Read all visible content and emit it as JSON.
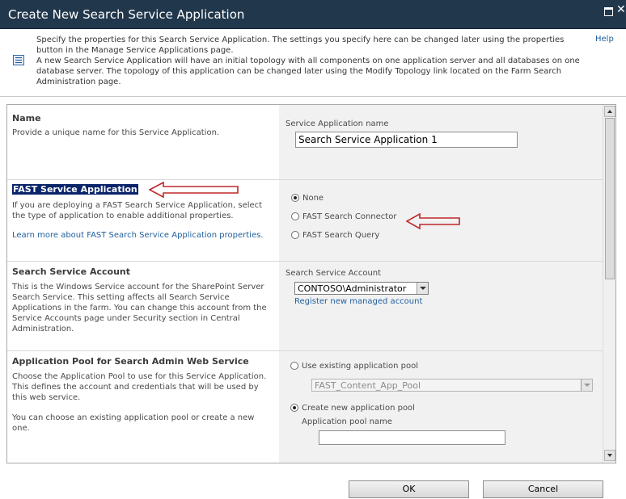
{
  "dialog": {
    "title": "Create New Search Service Application",
    "help_label": "Help",
    "description_1": "Specify the properties for this Search Service Application. The settings you specify here can be changed later using the properties button in the Manage Service Applications page.",
    "description_2": "A new Search Service Application will have an initial topology with all components on one application server and all databases on one database server. The topology of this application can be changed later using the Modify Topology link located on the Farm Search Administration page."
  },
  "sections": {
    "name": {
      "heading": "Name",
      "text": "Provide a unique name for this Service Application.",
      "field_label": "Service Application name",
      "field_value": "Search Service Application 1"
    },
    "fast": {
      "heading": "FAST Service Application",
      "text": "If you are deploying a FAST Search Service Application, select the type of application to enable additional properties.",
      "link": "Learn more about FAST Search Service Application properties.",
      "options": [
        "None",
        "FAST Search Connector",
        "FAST Search Query"
      ],
      "selected": "None"
    },
    "account": {
      "heading": "Search Service Account",
      "text": "This is the Windows Service account for the SharePoint Server Search Service. This setting affects all Search Service Applications in the farm. You can change this account from the Service Accounts page under Security section in Central Administration.",
      "field_label": "Search Service Account",
      "selected_account": "CONTOSO\\Administrator",
      "register_link": "Register new managed account"
    },
    "apppool": {
      "heading": "Application Pool for Search Admin Web Service",
      "text_1": "Choose the Application Pool to use for this Service Application. This defines the account and credentials that will be used by this web service.",
      "text_2": "You can choose an existing application pool or create a new one.",
      "use_existing_label": "Use existing application pool",
      "existing_pool": "FAST_Content_App_Pool",
      "create_new_label": "Create new application pool",
      "pool_name_label": "Application pool name",
      "pool_name_value": ""
    }
  },
  "buttons": {
    "ok": "OK",
    "cancel": "Cancel"
  },
  "colors": {
    "title_bar": "#21374c",
    "link": "#1f5f9e",
    "annotation_arrow": "#c0282a",
    "selection": "#0a246a"
  }
}
